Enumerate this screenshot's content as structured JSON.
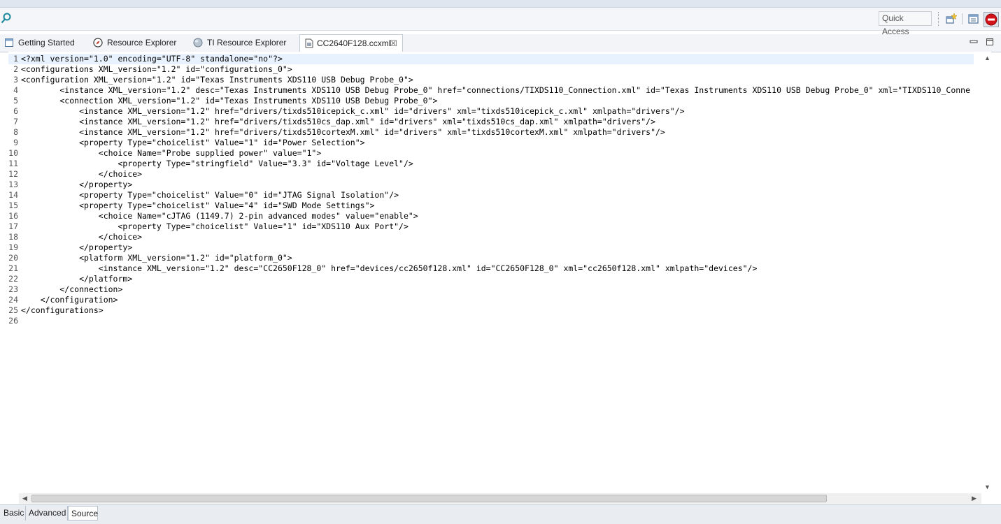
{
  "toolbar": {
    "quick_access": "Quick Access"
  },
  "tabs": [
    {
      "label": "Getting Started",
      "icon": "page-icon"
    },
    {
      "label": "Resource Explorer",
      "icon": "compass-icon"
    },
    {
      "label": "TI Resource Explorer",
      "icon": "globe-icon"
    },
    {
      "label": "CC2640F128.ccxml",
      "icon": "ccxml-file-icon",
      "active": true
    }
  ],
  "editor": {
    "current_line": 1,
    "lines": [
      {
        "n": "1",
        "text": "<?xml version=\"1.0\" encoding=\"UTF-8\" standalone=\"no\"?>"
      },
      {
        "n": "2",
        "text": "<configurations XML_version=\"1.2\" id=\"configurations_0\">"
      },
      {
        "n": "3",
        "text": "<configuration XML_version=\"1.2\" id=\"Texas Instruments XDS110 USB Debug Probe_0\">"
      },
      {
        "n": "4",
        "text": "        <instance XML_version=\"1.2\" desc=\"Texas Instruments XDS110 USB Debug Probe_0\" href=\"connections/TIXDS110_Connection.xml\" id=\"Texas Instruments XDS110 USB Debug Probe_0\" xml=\"TIXDS110_Conne"
      },
      {
        "n": "5",
        "text": "        <connection XML_version=\"1.2\" id=\"Texas Instruments XDS110 USB Debug Probe_0\">"
      },
      {
        "n": "6",
        "text": "            <instance XML_version=\"1.2\" href=\"drivers/tixds510icepick_c.xml\" id=\"drivers\" xml=\"tixds510icepick_c.xml\" xmlpath=\"drivers\"/>"
      },
      {
        "n": "7",
        "text": "            <instance XML_version=\"1.2\" href=\"drivers/tixds510cs_dap.xml\" id=\"drivers\" xml=\"tixds510cs_dap.xml\" xmlpath=\"drivers\"/>"
      },
      {
        "n": "8",
        "text": "            <instance XML_version=\"1.2\" href=\"drivers/tixds510cortexM.xml\" id=\"drivers\" xml=\"tixds510cortexM.xml\" xmlpath=\"drivers\"/>"
      },
      {
        "n": "9",
        "text": "            <property Type=\"choicelist\" Value=\"1\" id=\"Power Selection\">"
      },
      {
        "n": "10",
        "text": "                <choice Name=\"Probe supplied power\" value=\"1\">"
      },
      {
        "n": "11",
        "text": "                    <property Type=\"stringfield\" Value=\"3.3\" id=\"Voltage Level\"/>"
      },
      {
        "n": "12",
        "text": "                </choice>"
      },
      {
        "n": "13",
        "text": "            </property>"
      },
      {
        "n": "14",
        "text": "            <property Type=\"choicelist\" Value=\"0\" id=\"JTAG Signal Isolation\"/>"
      },
      {
        "n": "15",
        "text": "            <property Type=\"choicelist\" Value=\"4\" id=\"SWD Mode Settings\">"
      },
      {
        "n": "16",
        "text": "                <choice Name=\"cJTAG (1149.7) 2-pin advanced modes\" value=\"enable\">"
      },
      {
        "n": "17",
        "text": "                    <property Type=\"choicelist\" Value=\"1\" id=\"XDS110 Aux Port\"/>"
      },
      {
        "n": "18",
        "text": "                </choice>"
      },
      {
        "n": "19",
        "text": "            </property>"
      },
      {
        "n": "20",
        "text": "            <platform XML_version=\"1.2\" id=\"platform_0\">"
      },
      {
        "n": "21",
        "text": "                <instance XML_version=\"1.2\" desc=\"CC2650F128_0\" href=\"devices/cc2650f128.xml\" id=\"CC2650F128_0\" xml=\"cc2650f128.xml\" xmlpath=\"devices\"/>"
      },
      {
        "n": "22",
        "text": "            </platform>"
      },
      {
        "n": "23",
        "text": "        </connection>"
      },
      {
        "n": "24",
        "text": "    </configuration>"
      },
      {
        "n": "25",
        "text": "</configurations>"
      },
      {
        "n": "26",
        "text": ""
      }
    ]
  },
  "bottom_tabs": [
    {
      "label": "Basic"
    },
    {
      "label": "Advanced"
    },
    {
      "label": "Source",
      "active": true
    }
  ]
}
